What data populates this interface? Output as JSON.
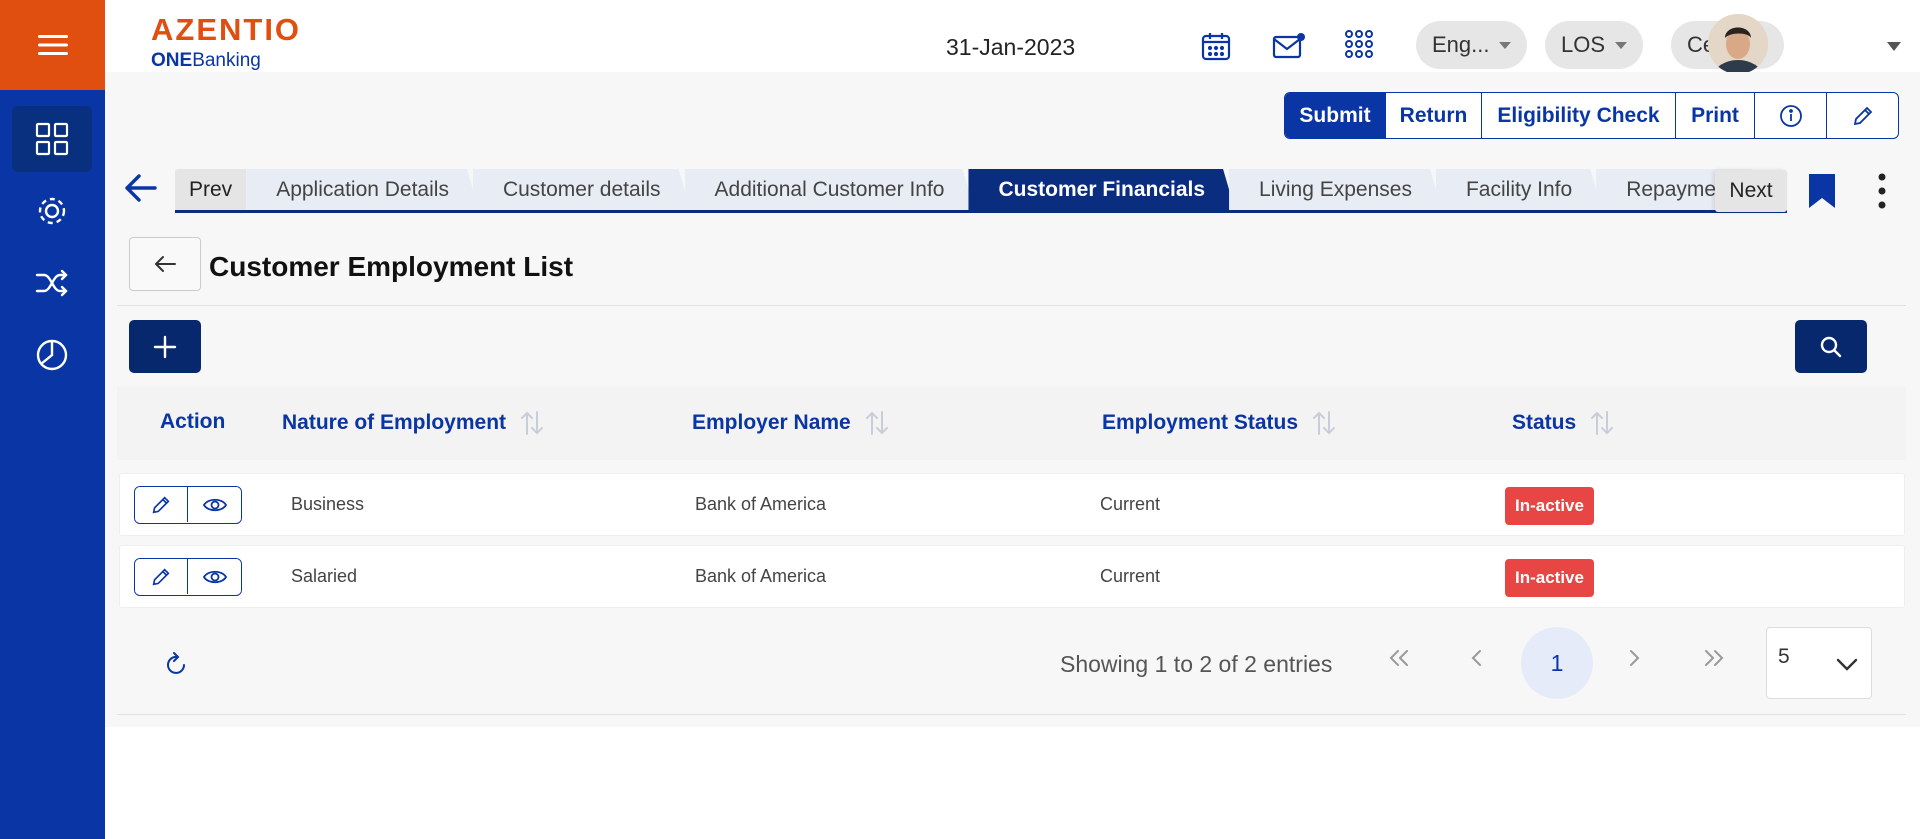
{
  "header": {
    "logo_brand": "AZENTIO",
    "logo_sub_bold": "ONE",
    "logo_sub_rest": "Banking",
    "date": "31-Jan-2023",
    "language": "Eng...",
    "module": "LOS",
    "branch": "Cen..."
  },
  "toolbar": {
    "submit": "Submit",
    "return": "Return",
    "eligibility": "Eligibility Check",
    "print": "Print"
  },
  "tabs": {
    "prev": "Prev",
    "next": "Next",
    "items": [
      {
        "label": "Application Details",
        "active": false
      },
      {
        "label": "Customer details",
        "active": false
      },
      {
        "label": "Additional Customer Info",
        "active": false
      },
      {
        "label": "Customer Financials",
        "active": true
      },
      {
        "label": "Living Expenses",
        "active": false
      },
      {
        "label": "Facility Info",
        "active": false
      },
      {
        "label": "Repayment",
        "active": false
      }
    ]
  },
  "page": {
    "title": "Customer Employment List"
  },
  "table": {
    "headers": {
      "action": "Action",
      "nature": "Nature of Employment",
      "employer": "Employer Name",
      "emp_status": "Employment Status",
      "status": "Status"
    },
    "rows": [
      {
        "nature": "Business",
        "employer": "Bank of America",
        "emp_status": "Current",
        "status": "In-active"
      },
      {
        "nature": "Salaried",
        "employer": "Bank of America",
        "emp_status": "Current",
        "status": "In-active"
      }
    ]
  },
  "pagination": {
    "summary": "Showing 1 to 2 of 2 entries",
    "current_page": "1",
    "page_size": "5"
  },
  "colors": {
    "sidebar": "#0a35a4",
    "brand_orange": "#e04e10",
    "primary": "#0a35a4",
    "badge_inactive": "#e84545"
  }
}
